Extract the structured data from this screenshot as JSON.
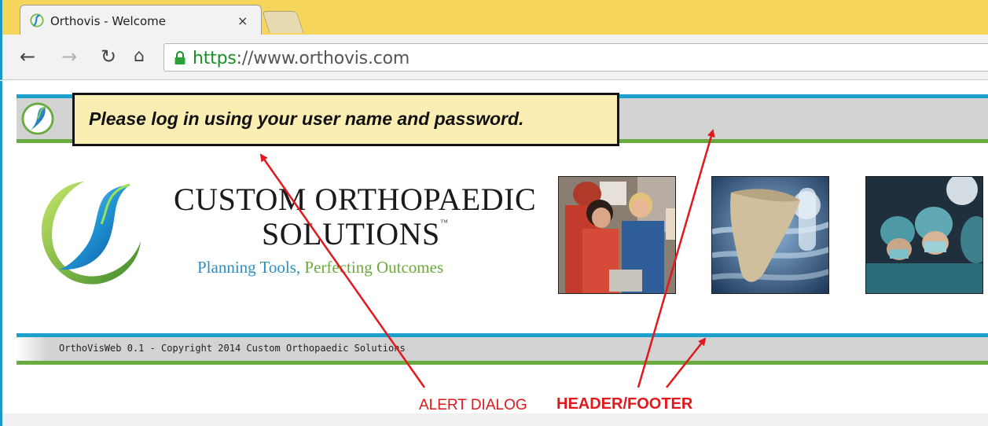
{
  "browser": {
    "tab_title": "Orthovis - Welcome",
    "tab_close": "×",
    "url_scheme": "https",
    "url_rest": "://www.orthovis.com"
  },
  "page": {
    "alert_message": "Please log in using your user name and password.",
    "brand_line_1": "CUSTOM ORTHOPAEDIC",
    "brand_line_2": "SOLUTIONS",
    "trademark": "™",
    "tagline_part_1": "Planning Tools, ",
    "tagline_part_2": "Perfecting Outcomes",
    "photos": [
      "clinicians-at-workstation",
      "shoulder-bone-xray",
      "surgeons-operating"
    ],
    "footer_text": "OrthoVisWeb 0.1 - Copyright 2014 Custom Orthopaedic Solutions"
  },
  "annotations": {
    "alert_label": "ALERT DIALOG",
    "header_footer_label": "HEADER/FOOTER"
  },
  "colors": {
    "title_bar": "#f5d65a",
    "header_blue": "#1ea0cc",
    "header_green": "#6aab3f",
    "header_gray": "#d3d3d3",
    "alert_bg": "#fbeeb3",
    "annotation_red": "#e1181c"
  }
}
